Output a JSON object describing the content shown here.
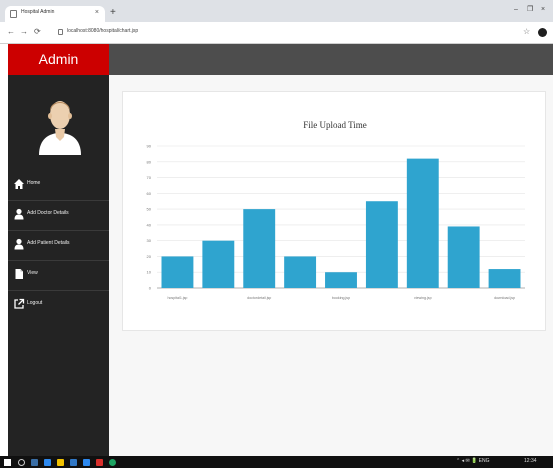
{
  "browser": {
    "tab_title": "Hospital Admin",
    "tab_close": "×",
    "new_tab": "+",
    "minimize": "–",
    "restore": "❐",
    "close": "×",
    "back": "←",
    "forward": "→",
    "reload": "⟳",
    "url": "localhost:8080/hospital/chart.jsp",
    "bookmark_star": "☆"
  },
  "app": {
    "brand": "Admin"
  },
  "sidebar": {
    "items": [
      {
        "label": "Home",
        "icon": "home-icon"
      },
      {
        "label": "Add Doctor Details",
        "icon": "user-icon"
      },
      {
        "label": "Add Patient Details",
        "icon": "user-icon"
      },
      {
        "label": "View",
        "icon": "file-icon"
      },
      {
        "label": "Logout",
        "icon": "external-link-icon"
      }
    ]
  },
  "chart_data": {
    "type": "bar",
    "title": "File Upload Time",
    "categories": [
      "hospital1.jsp",
      "",
      "doctordetail.jsp",
      "",
      "booking.jsp",
      "",
      "viewing.jsp",
      "",
      "download.jsp"
    ],
    "values": [
      20,
      30,
      50,
      20,
      10,
      55,
      82,
      39,
      12
    ],
    "ylim": [
      0,
      90
    ],
    "yticks": [
      0,
      10,
      20,
      30,
      40,
      50,
      60,
      70,
      80,
      90
    ],
    "grid": true,
    "bar_color": "#2fa4cf"
  },
  "taskbar": {
    "tray": "⌃ ◂ ✉ 🔋 ENG",
    "clock": "12:34"
  },
  "colors": {
    "brand_red": "#cc0000",
    "sidebar_bg": "#232323",
    "topbar_bg": "#4d4d4d",
    "bar": "#2fa4cf"
  }
}
